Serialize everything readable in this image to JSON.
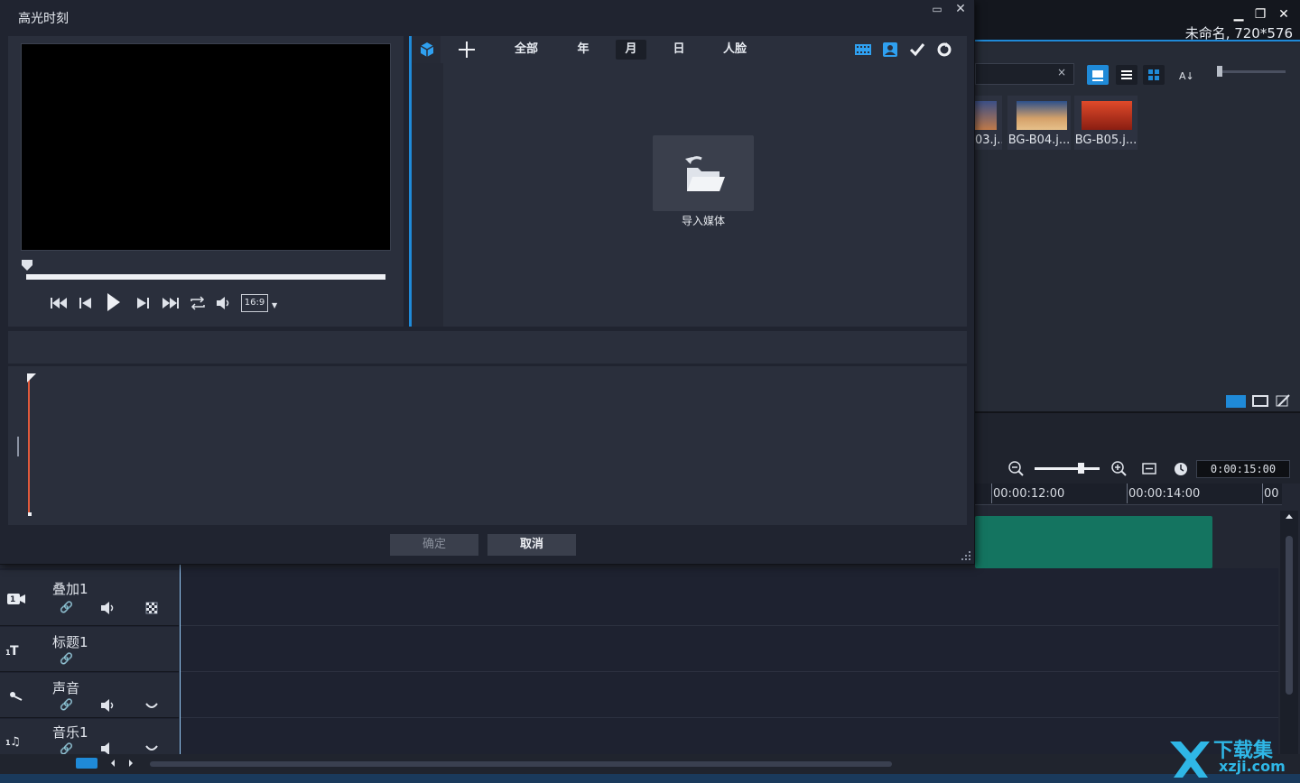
{
  "dialog": {
    "title": "高光时刻",
    "tabs": [
      {
        "label": "全部",
        "active": false
      },
      {
        "label": "年",
        "active": false
      },
      {
        "label": "月",
        "active": true
      },
      {
        "label": "日",
        "active": false
      },
      {
        "label": "人脸",
        "active": false
      }
    ],
    "import_label": "导入媒体",
    "aspect_ratio": "16:9",
    "ok_label": "确定",
    "cancel_label": "取消"
  },
  "app": {
    "project_title": "未命名, 720*576",
    "library": {
      "search_clear": "×",
      "thumbnails": [
        {
          "label": "03.j..."
        },
        {
          "label": "BG-B04.j..."
        },
        {
          "label": "BG-B05.j..."
        }
      ]
    },
    "timeline": {
      "timecode": "0:00:15:00",
      "ruler_labels": [
        "00:00:12:00",
        "00:00:14:00",
        "00"
      ],
      "tracks": [
        {
          "name": "叠加1"
        },
        {
          "name": "标题1"
        },
        {
          "name": "声音"
        },
        {
          "name": "音乐1"
        }
      ]
    }
  },
  "watermark": {
    "text": "下载集",
    "sub": "xzji.com"
  },
  "colors": {
    "accent": "#1f8ad8",
    "clip": "#147460",
    "marker": "#e15a3c"
  }
}
